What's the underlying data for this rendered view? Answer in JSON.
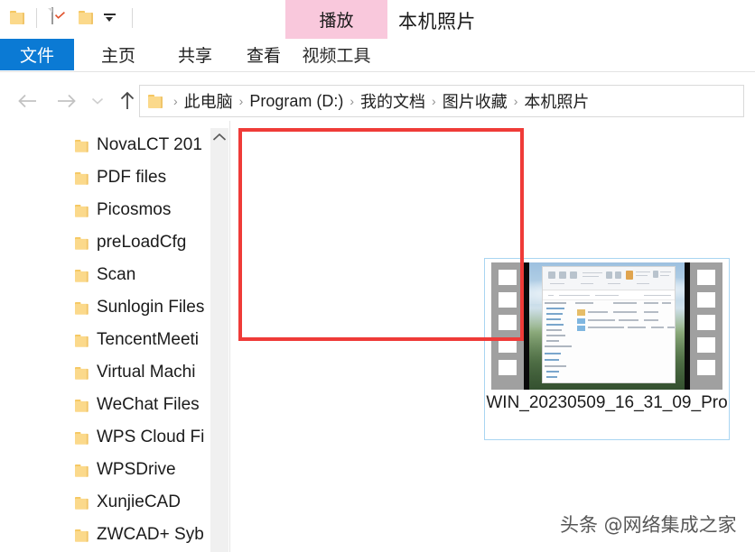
{
  "window": {
    "title": "本机照片"
  },
  "quick_access": {
    "items": [
      {
        "name": "folder-icon",
        "label": ""
      },
      {
        "name": "properties-icon",
        "label": ""
      },
      {
        "name": "new-folder-icon",
        "label": ""
      },
      {
        "name": "customize-dropdown-icon",
        "label": ""
      }
    ]
  },
  "contextual": {
    "group_label": "视频工具",
    "active_tab": "播放",
    "tab_color": "#f9c8dc"
  },
  "ribbon": {
    "tabs": [
      {
        "label": "文件",
        "active": true,
        "color": "#0b7ad4"
      },
      {
        "label": "主页",
        "active": false,
        "color": ""
      },
      {
        "label": "共享",
        "active": false,
        "color": ""
      },
      {
        "label": "查看",
        "active": false,
        "color": ""
      },
      {
        "label": "视频工具",
        "active": false,
        "color": ""
      }
    ]
  },
  "nav": {
    "back_icon": "arrow-left-icon",
    "forward_icon": "arrow-right-icon",
    "recent_icon": "chevron-down-icon",
    "up_icon": "arrow-up-icon",
    "breadcrumbs": [
      "此电脑",
      "Program (D:)",
      "我的文档",
      "图片收藏",
      "本机照片"
    ],
    "separator": "›"
  },
  "sidebar": {
    "items": [
      {
        "label": "NovaLCT 201",
        "icon": "folder-icon"
      },
      {
        "label": "PDF files",
        "icon": "folder-icon"
      },
      {
        "label": "Picosmos",
        "icon": "folder-icon"
      },
      {
        "label": "preLoadCfg",
        "icon": "folder-icon"
      },
      {
        "label": "Scan",
        "icon": "folder-icon"
      },
      {
        "label": "Sunlogin Files",
        "icon": "folder-icon"
      },
      {
        "label": "TencentMeeti",
        "icon": "folder-icon"
      },
      {
        "label": "Virtual Machi",
        "icon": "folder-icon"
      },
      {
        "label": "WeChat Files",
        "icon": "folder-icon"
      },
      {
        "label": "WPS Cloud Fi",
        "icon": "folder-icon"
      },
      {
        "label": "WPSDrive",
        "icon": "folder-icon"
      },
      {
        "label": "XunjieCAD",
        "icon": "folder-icon"
      },
      {
        "label": "ZWCAD+ Syb",
        "icon": "folder-icon"
      }
    ],
    "scroll_up_icon": "chevron-up-icon"
  },
  "content": {
    "annotation_color": "#ef3b38",
    "selection_border": "#a9d5f2",
    "file": {
      "name": "WIN_20230509_16_31_09_Pro",
      "thumbnail_type": "video-filmstrip",
      "sprocket_count": 5
    }
  },
  "watermark": {
    "text": "头条 @网络集成之家"
  }
}
